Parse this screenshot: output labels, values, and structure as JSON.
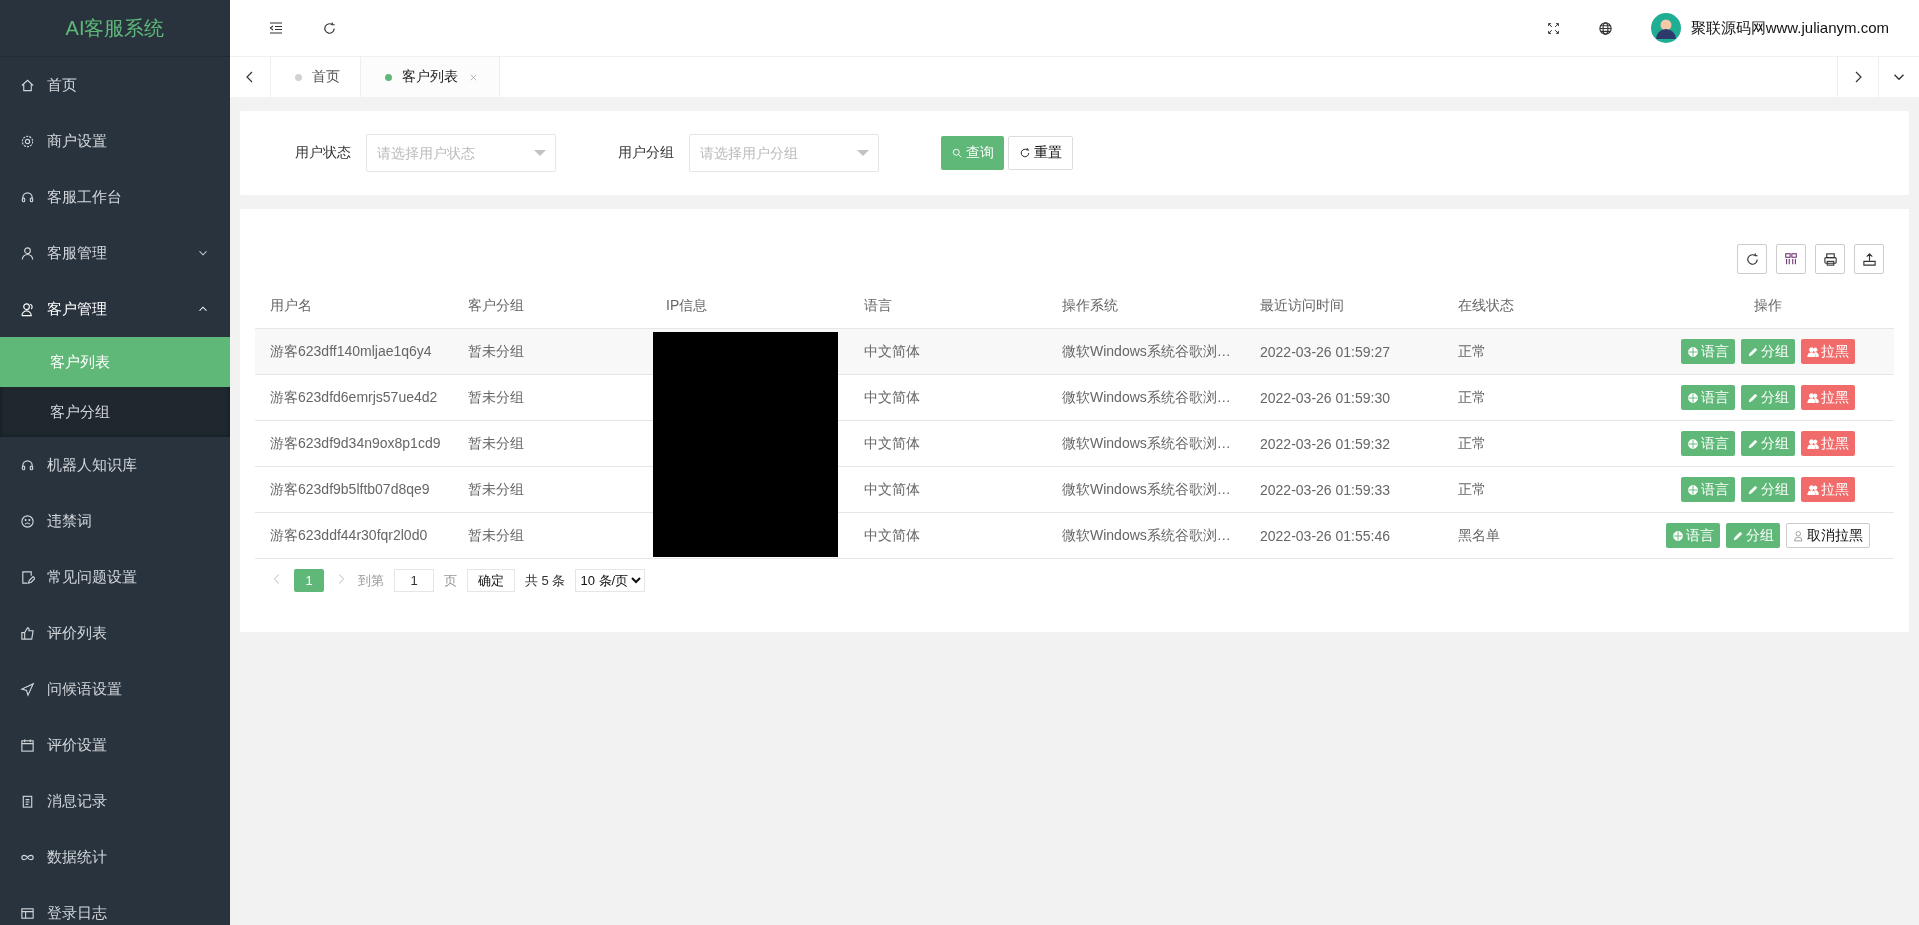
{
  "sidebar": {
    "logo": "AI客服系统",
    "items": [
      {
        "label": "首页",
        "selected": false
      },
      {
        "label": "商户设置",
        "selected": false
      },
      {
        "label": "客服工作台",
        "selected": false
      },
      {
        "label": "客服管理",
        "selected": false,
        "expanded": false
      },
      {
        "label": "客户管理",
        "selected": false,
        "expanded": true,
        "children": [
          {
            "label": "客户列表",
            "selected": true
          },
          {
            "label": "客户分组",
            "selected": false
          }
        ]
      },
      {
        "label": "机器人知识库",
        "selected": false
      },
      {
        "label": "违禁词",
        "selected": false
      },
      {
        "label": "常见问题设置",
        "selected": false
      },
      {
        "label": "评价列表",
        "selected": false
      },
      {
        "label": "问候语设置",
        "selected": false
      },
      {
        "label": "评价设置",
        "selected": false
      },
      {
        "label": "消息记录",
        "selected": false
      },
      {
        "label": "数据统计",
        "selected": false
      },
      {
        "label": "登录日志",
        "selected": false
      }
    ]
  },
  "header": {
    "user_name": "聚联源码网www.julianym.com"
  },
  "tabs": [
    {
      "label": "首页",
      "selected": false
    },
    {
      "label": "客户列表",
      "selected": true
    }
  ],
  "filters": [
    {
      "label": "用户状态",
      "placeholder": "请选择用户状态"
    },
    {
      "label": "用户分组",
      "placeholder": "请选择用户分组"
    }
  ],
  "filter_buttons": [
    {
      "label": "查询",
      "kind": "primary"
    },
    {
      "label": "重置",
      "kind": "default"
    }
  ],
  "table": {
    "columns": [
      "用户名",
      "客户分组",
      "IP信息",
      "语言",
      "操作系统",
      "最近访问时间",
      "在线状态",
      "操作"
    ],
    "rows": [
      {
        "username": "游客623dff140mljae1q6y4",
        "group": "暂未分组",
        "language": "中文简体",
        "os": "微软Windows系统谷歌浏…",
        "last_visit": "2022-03-26 01:59:27",
        "status": "正常",
        "actions": [
          {
            "label": "语言",
            "kind": "language"
          },
          {
            "label": "分组",
            "kind": "group"
          },
          {
            "label": "拉黑",
            "kind": "block"
          }
        ]
      },
      {
        "username": "游客623dfd6emrjs57ue4d2",
        "group": "暂未分组",
        "language": "中文简体",
        "os": "微软Windows系统谷歌浏…",
        "last_visit": "2022-03-26 01:59:30",
        "status": "正常",
        "actions": [
          {
            "label": "语言",
            "kind": "language"
          },
          {
            "label": "分组",
            "kind": "group"
          },
          {
            "label": "拉黑",
            "kind": "block"
          }
        ]
      },
      {
        "username": "游客623df9d34n9ox8p1cd9",
        "group": "暂未分组",
        "language": "中文简体",
        "os": "微软Windows系统谷歌浏…",
        "last_visit": "2022-03-26 01:59:32",
        "status": "正常",
        "actions": [
          {
            "label": "语言",
            "kind": "language"
          },
          {
            "label": "分组",
            "kind": "group"
          },
          {
            "label": "拉黑",
            "kind": "block"
          }
        ]
      },
      {
        "username": "游客623df9b5lftb07d8qe9",
        "group": "暂未分组",
        "language": "中文简体",
        "os": "微软Windows系统谷歌浏…",
        "last_visit": "2022-03-26 01:59:33",
        "status": "正常",
        "actions": [
          {
            "label": "语言",
            "kind": "language"
          },
          {
            "label": "分组",
            "kind": "group"
          },
          {
            "label": "拉黑",
            "kind": "block"
          }
        ]
      },
      {
        "username": "游客623ddf44r30fqr2l0d0",
        "group": "暂未分组",
        "language": "中文简体",
        "os": "微软Windows系统谷歌浏…",
        "last_visit": "2022-03-26 01:55:46",
        "status": "黑名单",
        "actions": [
          {
            "label": "语言",
            "kind": "language"
          },
          {
            "label": "分组",
            "kind": "group"
          },
          {
            "label": "取消拉黑",
            "kind": "unblock"
          }
        ]
      }
    ]
  },
  "pagination": {
    "pages": [
      {
        "label": "1",
        "selected": true
      }
    ],
    "jump_label": "到第",
    "jump_value": "1",
    "page_unit": "页",
    "confirm": "确定",
    "total": "共 5 条",
    "page_size": "10 条/页"
  }
}
